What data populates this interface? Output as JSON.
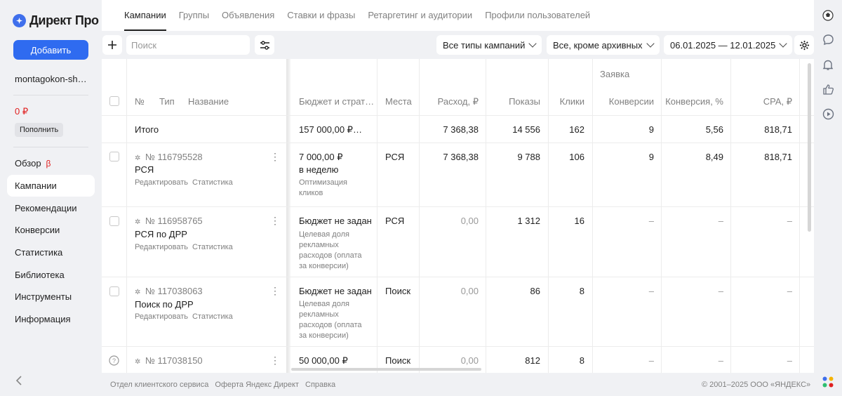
{
  "sidebar": {
    "logo": "Директ Про",
    "add_label": "Добавить",
    "account": "montagokon-sh…",
    "balance": "0 ₽",
    "topup_label": "Пополнить",
    "nav": [
      {
        "label": "Обзор",
        "badge": "β"
      },
      {
        "label": "Кампании"
      },
      {
        "label": "Рекомендации"
      },
      {
        "label": "Конверсии"
      },
      {
        "label": "Статистика"
      },
      {
        "label": "Библиотека"
      },
      {
        "label": "Инструменты"
      },
      {
        "label": "Информация"
      }
    ]
  },
  "tabs": [
    "Кампании",
    "Группы",
    "Объявления",
    "Ставки и фразы",
    "Ретаргетинг и аудитории",
    "Профили пользователей"
  ],
  "filters": {
    "search_placeholder": "Поиск",
    "campaign_type": "Все типы кампаний",
    "status": "Все, кроме архивных",
    "date_range": "06.01.2025 — 12.01.2025"
  },
  "table": {
    "group_header": "Заявка",
    "headers": {
      "num": "№",
      "type": "Тип",
      "name": "Название",
      "budget": "Бюджет и страт…",
      "places": "Места",
      "spend": "Расход, ₽",
      "shows": "Показы",
      "clicks": "Клики",
      "conversions": "Конверсии",
      "conv_rate": "Конверсия, %",
      "cpa": "CPA, ₽"
    },
    "total": {
      "label": "Итого",
      "budget": "157 000,00 ₽…",
      "spend": "7 368,38",
      "shows": "14 556",
      "clicks": "162",
      "conversions": "9",
      "conv_rate": "5,56",
      "cpa": "818,71"
    },
    "rows": [
      {
        "num": "№ 116795528",
        "name": "РСЯ",
        "edit": "Редактировать",
        "stats": "Статистика",
        "budget": "7 000,00 ₽",
        "budget_sub": "в неделю",
        "strategy": "Оптимизация кликов",
        "places": "РСЯ",
        "spend": "7 368,38",
        "shows": "9 788",
        "clicks": "106",
        "conversions": "9",
        "conv_rate": "8,49",
        "cpa": "818,71"
      },
      {
        "num": "№ 116958765",
        "name": "РСЯ по ДРР",
        "edit": "Редактировать",
        "stats": "Статистика",
        "budget": "Бюджет не задан",
        "budget_sub": "",
        "strategy": "Целевая доля рекламных расходов (оплата за конверсии)",
        "places": "РСЯ",
        "spend": "0,00",
        "shows": "1 312",
        "clicks": "16",
        "conversions": "–",
        "conv_rate": "–",
        "cpa": "–"
      },
      {
        "num": "№ 117038063",
        "name": "Поиск по ДРР",
        "edit": "Редактировать",
        "stats": "Статистика",
        "budget": "Бюджет не задан",
        "budget_sub": "",
        "strategy": "Целевая доля рекламных расходов (оплата за конверсии)",
        "places": "Поиск",
        "spend": "0,00",
        "shows": "86",
        "clicks": "8",
        "conversions": "–",
        "conv_rate": "–",
        "cpa": "–"
      },
      {
        "num": "№ 117038150",
        "name": "",
        "edit": "",
        "stats": "",
        "budget": "50 000,00 ₽",
        "budget_sub": "",
        "strategy": "",
        "places": "Поиск",
        "spend": "0,00",
        "shows": "812",
        "clicks": "8",
        "conversions": "–",
        "conv_rate": "–",
        "cpa": "–"
      }
    ]
  },
  "footer": {
    "links": [
      "Отдел клиентского сервиса",
      "Оферта Яндекс Директ",
      "Справка"
    ],
    "copyright": "© 2001–2025 ООО «ЯНДЕКС»"
  },
  "colors": {
    "accent": "#2f6bf0",
    "danger": "#e02020",
    "background": "#f0f1f4"
  },
  "icons": [
    "logo-icon",
    "plus-icon",
    "filter-settings-icon",
    "gear-icon",
    "chevron-down-icon",
    "kebab-icon",
    "help-icon",
    "chat-icon",
    "bell-icon",
    "like-icon",
    "play-icon",
    "collapse-arrow-icon",
    "apps-icon",
    "avatar-icon"
  ]
}
